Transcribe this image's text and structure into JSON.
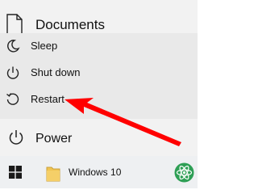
{
  "menu": {
    "documents_label": "Documents",
    "power_options": [
      {
        "label": "Sleep",
        "icon": "sleep-icon"
      },
      {
        "label": "Shut down",
        "icon": "power-icon"
      },
      {
        "label": "Restart",
        "icon": "restart-icon"
      }
    ],
    "power_label": "Power"
  },
  "taskbar": {
    "window_label": "Windows 10",
    "start_icon": "windows-logo-icon",
    "folder_icon": "folder-icon",
    "app_icon": "atom-app-icon"
  },
  "annotation": {
    "color": "#ff0000"
  }
}
